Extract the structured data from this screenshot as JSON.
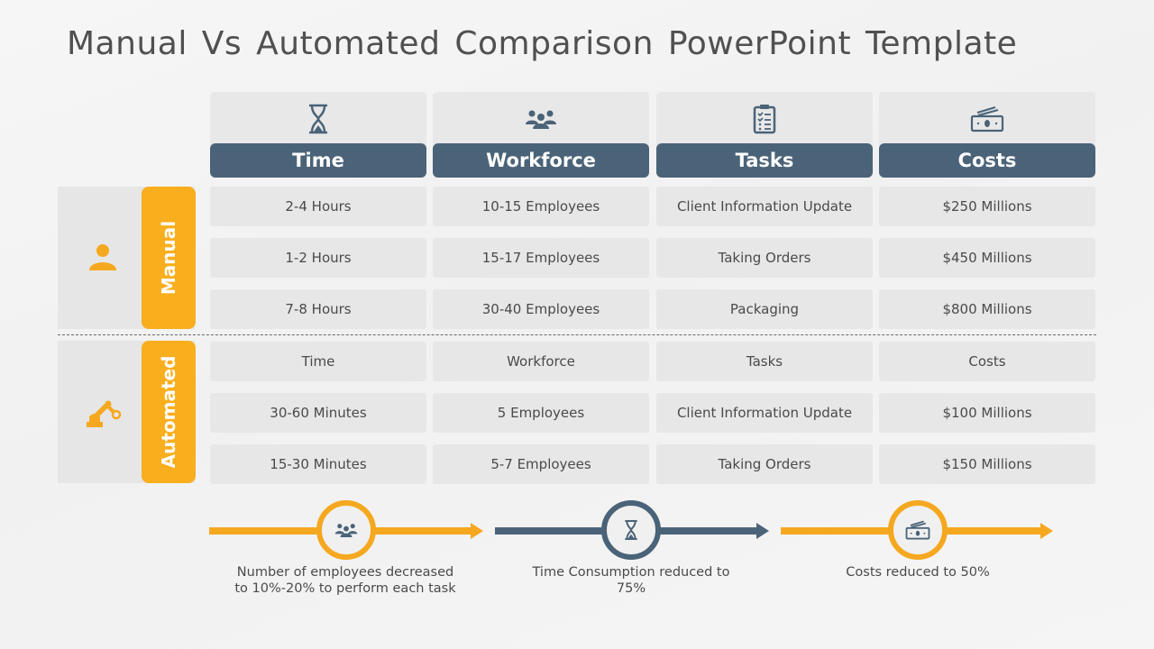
{
  "title": "Manual Vs Automated Comparison PowerPoint Template",
  "colors": {
    "header_bg": "#4a6378",
    "accent": "#f8ae1d",
    "cell_bg": "#e7e7e7",
    "icon_dark": "#4a6378"
  },
  "columns": [
    {
      "label": "Time",
      "icon": "hourglass-icon"
    },
    {
      "label": "Workforce",
      "icon": "group-icon"
    },
    {
      "label": "Tasks",
      "icon": "clipboard-checklist-icon"
    },
    {
      "label": "Costs",
      "icon": "money-icon"
    }
  ],
  "sections": [
    {
      "label": "Manual",
      "icon": "person-icon",
      "rows": [
        [
          "2-4 Hours",
          "10-15 Employees",
          "Client Information Update",
          "$250 Millions"
        ],
        [
          "1-2 Hours",
          "15-17 Employees",
          "Taking Orders",
          "$450 Millions"
        ],
        [
          "7-8 Hours",
          "30-40 Employees",
          "Packaging",
          "$800 Millions"
        ]
      ]
    },
    {
      "label": "Automated",
      "icon": "robot-arm-icon",
      "rows": [
        [
          "Time",
          "Workforce",
          "Tasks",
          "Costs"
        ],
        [
          "30-60 Minutes",
          "5 Employees",
          "Client Information Update",
          "$100 Millions"
        ],
        [
          "15-30 Minutes",
          "5-7 Employees",
          "Taking Orders",
          "$150 Millions"
        ]
      ]
    }
  ],
  "highlights": [
    {
      "icon": "group-icon",
      "color": "#f5a81f",
      "text_line1": "Number of employees decreased",
      "text_line2": "to 10%-20% to perform each task"
    },
    {
      "icon": "hourglass-icon",
      "color": "#4a6378",
      "text_line1": "Time Consumption reduced to",
      "text_line2": "75%"
    },
    {
      "icon": "money-icon",
      "color": "#f5a81f",
      "text_line1": "Costs reduced to 50%",
      "text_line2": ""
    }
  ]
}
